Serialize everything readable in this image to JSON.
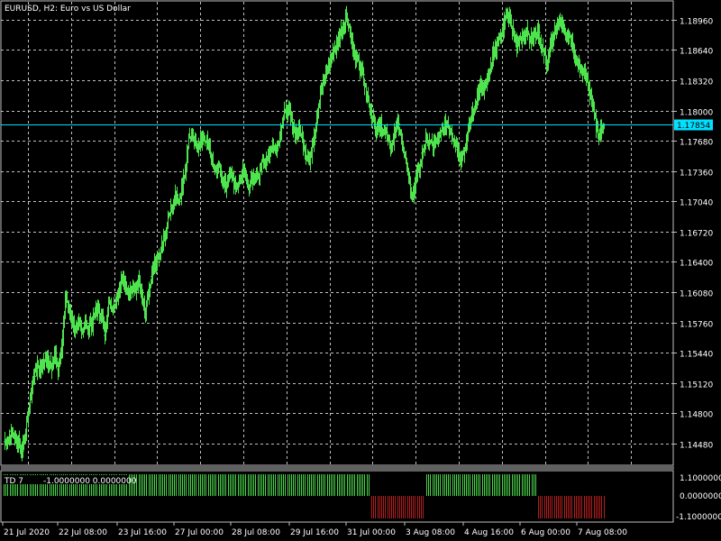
{
  "title": "EURUSD, H2:  Euro vs US Dollar",
  "colors": {
    "background": "#000000",
    "grid": "#c0c0c0",
    "bar": "#4ee44e",
    "price_line": "#00e0ff",
    "td_positive": "#4bd34b",
    "td_negative": "#b01e1e"
  },
  "indicator": {
    "name": "TD 7",
    "values": "-1.0000000 0.0000000",
    "scale": [
      "1.1000000",
      "0.0000000",
      "-1.1000000"
    ]
  },
  "current_price": "1.17854",
  "chart_data": {
    "type": "ohlc",
    "title": "EURUSD, H2:  Euro vs US Dollar",
    "timeframe": "H2",
    "ylim": [
      1.1425,
      1.1915
    ],
    "y_tick_labels": [
      "1.18960",
      "1.18640",
      "1.18320",
      "1.18000",
      "1.17680",
      "1.17360",
      "1.17040",
      "1.16720",
      "1.16400",
      "1.16080",
      "1.15760",
      "1.15440",
      "1.15120",
      "1.14800",
      "1.14480"
    ],
    "x_tick_labels": [
      "21 Jul 2020",
      "22 Jul 08:00",
      "23 Jul 16:00",
      "27 Jul 00:00",
      "28 Jul 08:00",
      "29 Jul 16:00",
      "31 Jul 00:00",
      "3 Aug 08:00",
      "4 Aug 16:00",
      "6 Aug 00:00",
      "7 Aug 08:00"
    ],
    "price_path": [
      1.145,
      1.1452,
      1.146,
      1.1455,
      1.145,
      1.144,
      1.1455,
      1.148,
      1.151,
      1.1525,
      1.153,
      1.1528,
      1.154,
      1.1535,
      1.153,
      1.1545,
      1.152,
      1.155,
      1.16,
      1.159,
      1.158,
      1.157,
      1.1575,
      1.1568,
      1.1572,
      1.157,
      1.1575,
      1.1585,
      1.159,
      1.158,
      1.156,
      1.16,
      1.159,
      1.16,
      1.161,
      1.162,
      1.1612,
      1.1605,
      1.1615,
      1.161,
      1.162,
      1.16,
      1.1585,
      1.161,
      1.1625,
      1.164,
      1.1645,
      1.166,
      1.167,
      1.169,
      1.17,
      1.171,
      1.1705,
      1.172,
      1.174,
      1.177,
      1.1775,
      1.1765,
      1.176,
      1.1775,
      1.177,
      1.176,
      1.1745,
      1.1735,
      1.174,
      1.1725,
      1.172,
      1.1735,
      1.173,
      1.1715,
      1.1725,
      1.1735,
      1.173,
      1.172,
      1.1725,
      1.173,
      1.1735,
      1.1745,
      1.175,
      1.1755,
      1.176,
      1.176,
      1.177,
      1.179,
      1.18,
      1.1795,
      1.1785,
      1.1775,
      1.178,
      1.1765,
      1.1755,
      1.1745,
      1.177,
      1.179,
      1.181,
      1.183,
      1.184,
      1.185,
      1.186,
      1.187,
      1.188,
      1.189,
      1.19,
      1.1885,
      1.1865,
      1.1855,
      1.1845,
      1.1835,
      1.182,
      1.18,
      1.179,
      1.178,
      1.1785,
      1.1775,
      1.178,
      1.176,
      1.177,
      1.179,
      1.178,
      1.176,
      1.174,
      1.172,
      1.171,
      1.173,
      1.1745,
      1.176,
      1.177,
      1.1765,
      1.176,
      1.177,
      1.1775,
      1.178,
      1.1785,
      1.178,
      1.177,
      1.176,
      1.175,
      1.1755,
      1.177,
      1.179,
      1.18,
      1.1815,
      1.1825,
      1.182,
      1.183,
      1.1845,
      1.186,
      1.187,
      1.188,
      1.189,
      1.19,
      1.1895,
      1.188,
      1.187,
      1.1875,
      1.188,
      1.1885,
      1.1875,
      1.188,
      1.1885,
      1.1875,
      1.186,
      1.185,
      1.187,
      1.188,
      1.189,
      1.1895,
      1.1885,
      1.188,
      1.1875,
      1.186,
      1.185,
      1.1845,
      1.184,
      1.183,
      1.1815,
      1.1795,
      1.1775,
      1.178,
      1.1785
    ]
  }
}
